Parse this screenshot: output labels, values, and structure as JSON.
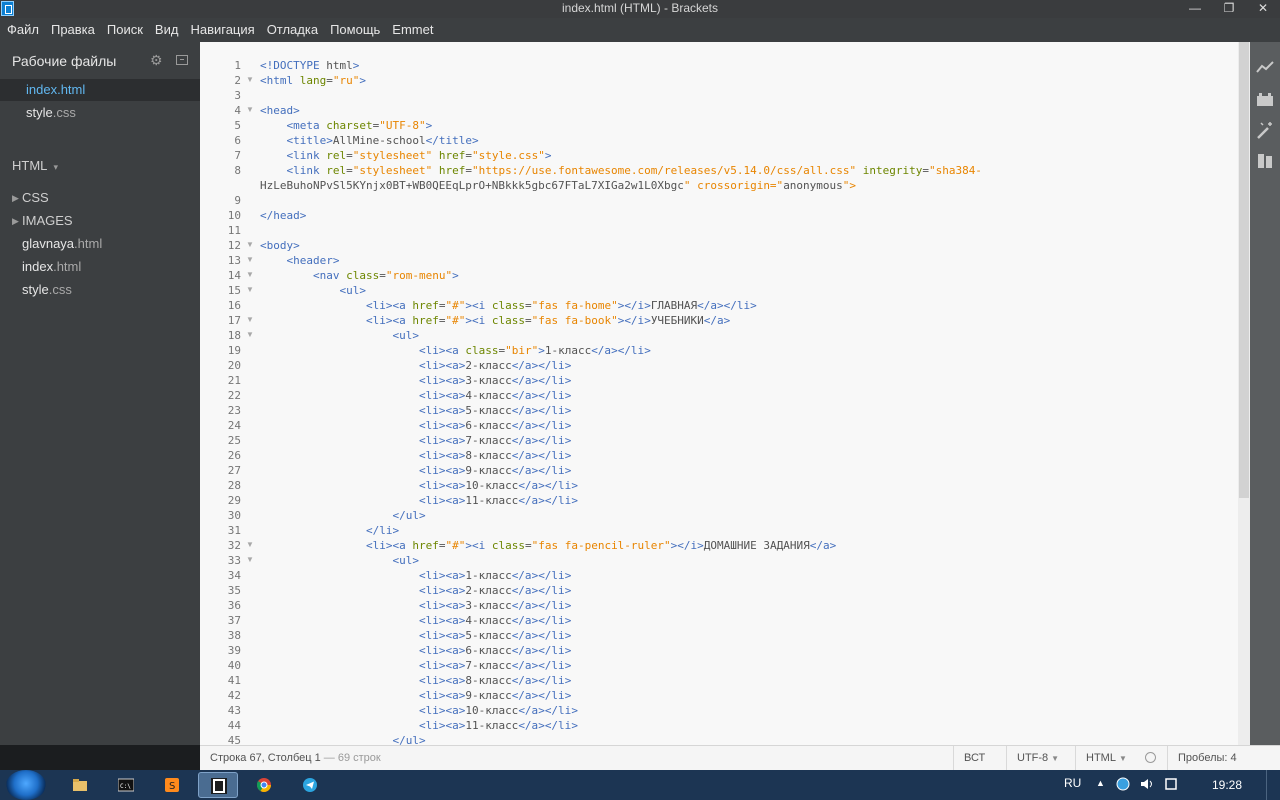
{
  "window": {
    "title": "index.html (HTML) - Brackets",
    "controls": {
      "minimize": "—",
      "maximize": "❐",
      "close": "✕"
    }
  },
  "menu": [
    "Файл",
    "Правка",
    "Поиск",
    "Вид",
    "Навигация",
    "Отладка",
    "Помощь",
    "Emmet"
  ],
  "sidebar": {
    "working_files_title": "Рабочие файлы",
    "working_files": [
      {
        "name": "index",
        "ext": ".html",
        "active": true
      },
      {
        "name": "style",
        "ext": ".css",
        "active": false
      }
    ],
    "project": {
      "label": "HTML",
      "caret": "▾"
    },
    "tree": [
      {
        "name": "CSS",
        "ext": "",
        "folder": true
      },
      {
        "name": "IMAGES",
        "ext": "",
        "folder": true
      },
      {
        "name": "glavnaya",
        "ext": ".html",
        "folder": false
      },
      {
        "name": "index",
        "ext": ".html",
        "folder": false
      },
      {
        "name": "style",
        "ext": ".css",
        "folder": false
      }
    ]
  },
  "editor": {
    "lines": [
      {
        "n": "1",
        "t": "<!DOCTYPE html>"
      },
      {
        "n": "2",
        "f": true,
        "t": "<html lang=\"ru\">"
      },
      {
        "n": "3",
        "t": ""
      },
      {
        "n": "4",
        "f": true,
        "t": "<head>"
      },
      {
        "n": "5",
        "t": "    <meta charset=\"UTF-8\">"
      },
      {
        "n": "6",
        "t": "    <title>AllMine-school</title>"
      },
      {
        "n": "7",
        "t": "    <link rel=\"stylesheet\" href=\"style.css\">"
      },
      {
        "n": "8",
        "t": "    <link rel=\"stylesheet\" href=\"https://use.fontawesome.com/releases/v5.14.0/css/all.css\" integrity=\"sha384-"
      },
      {
        "n": "",
        "t": "HzLeBuhoNPvSl5KYnjx0BT+WB0QEEqLprO+NBkkk5gbc67FTaL7XIGa2w1L0Xbgc\" crossorigin=\"anonymous\">"
      },
      {
        "n": "9",
        "t": ""
      },
      {
        "n": "10",
        "t": "</head>"
      },
      {
        "n": "11",
        "t": ""
      },
      {
        "n": "12",
        "f": true,
        "t": "<body>"
      },
      {
        "n": "13",
        "f": true,
        "t": "    <header>"
      },
      {
        "n": "14",
        "f": true,
        "t": "        <nav class=\"rom-menu\">"
      },
      {
        "n": "15",
        "f": true,
        "t": "            <ul>"
      },
      {
        "n": "16",
        "t": "                <li><a href=\"#\"><i class=\"fas fa-home\"></i>ГЛАВНАЯ</a></li>"
      },
      {
        "n": "17",
        "f": true,
        "t": "                <li><a href=\"#\"><i class=\"fas fa-book\"></i>УЧЕБНИКИ</a>"
      },
      {
        "n": "18",
        "f": true,
        "t": "                    <ul>"
      },
      {
        "n": "19",
        "t": "                        <li><a class=\"bir\">1-класс</a></li>"
      },
      {
        "n": "20",
        "t": "                        <li><a>2-класс</a></li>"
      },
      {
        "n": "21",
        "t": "                        <li><a>3-класс</a></li>"
      },
      {
        "n": "22",
        "t": "                        <li><a>4-класс</a></li>"
      },
      {
        "n": "23",
        "t": "                        <li><a>5-класс</a></li>"
      },
      {
        "n": "24",
        "t": "                        <li><a>6-класс</a></li>"
      },
      {
        "n": "25",
        "t": "                        <li><a>7-класс</a></li>"
      },
      {
        "n": "26",
        "t": "                        <li><a>8-класс</a></li>"
      },
      {
        "n": "27",
        "t": "                        <li><a>9-класс</a></li>"
      },
      {
        "n": "28",
        "t": "                        <li><a>10-класс</a></li>"
      },
      {
        "n": "29",
        "t": "                        <li><a>11-класс</a></li>"
      },
      {
        "n": "30",
        "t": "                    </ul>"
      },
      {
        "n": "31",
        "t": "                </li>"
      },
      {
        "n": "32",
        "f": true,
        "t": "                <li><a href=\"#\"><i class=\"fas fa-pencil-ruler\"></i>ДОМАШНИЕ ЗАДАНИЯ</a>"
      },
      {
        "n": "33",
        "f": true,
        "t": "                    <ul>"
      },
      {
        "n": "34",
        "t": "                        <li><a>1-класс</a></li>"
      },
      {
        "n": "35",
        "t": "                        <li><a>2-класс</a></li>"
      },
      {
        "n": "36",
        "t": "                        <li><a>3-класс</a></li>"
      },
      {
        "n": "37",
        "t": "                        <li><a>4-класс</a></li>"
      },
      {
        "n": "38",
        "t": "                        <li><a>5-класс</a></li>"
      },
      {
        "n": "39",
        "t": "                        <li><a>6-класс</a></li>"
      },
      {
        "n": "40",
        "t": "                        <li><a>7-класс</a></li>"
      },
      {
        "n": "41",
        "t": "                        <li><a>8-класс</a></li>"
      },
      {
        "n": "42",
        "t": "                        <li><a>9-класс</a></li>"
      },
      {
        "n": "43",
        "t": "                        <li><a>10-класс</a></li>"
      },
      {
        "n": "44",
        "t": "                        <li><a>11-класс</a></li>"
      },
      {
        "n": "45",
        "t": "                    </ul>"
      }
    ]
  },
  "toolbar_icons": [
    "live-preview-icon",
    "extension-manager-icon",
    "beautify-icon",
    "extract-icon"
  ],
  "status": {
    "position": "Строка 67, Столбец 1",
    "lines": " — 69 строк",
    "insert_mode": "ВСТ",
    "encoding": "UTF-8",
    "language": "HTML",
    "spaces": "Пробелы:  4"
  },
  "taskbar": {
    "apps": [
      "explorer",
      "cmd",
      "sublime-text",
      "brackets",
      "chrome",
      "telegram"
    ],
    "active_app": "brackets",
    "lang": "RU",
    "time": "19:28"
  }
}
